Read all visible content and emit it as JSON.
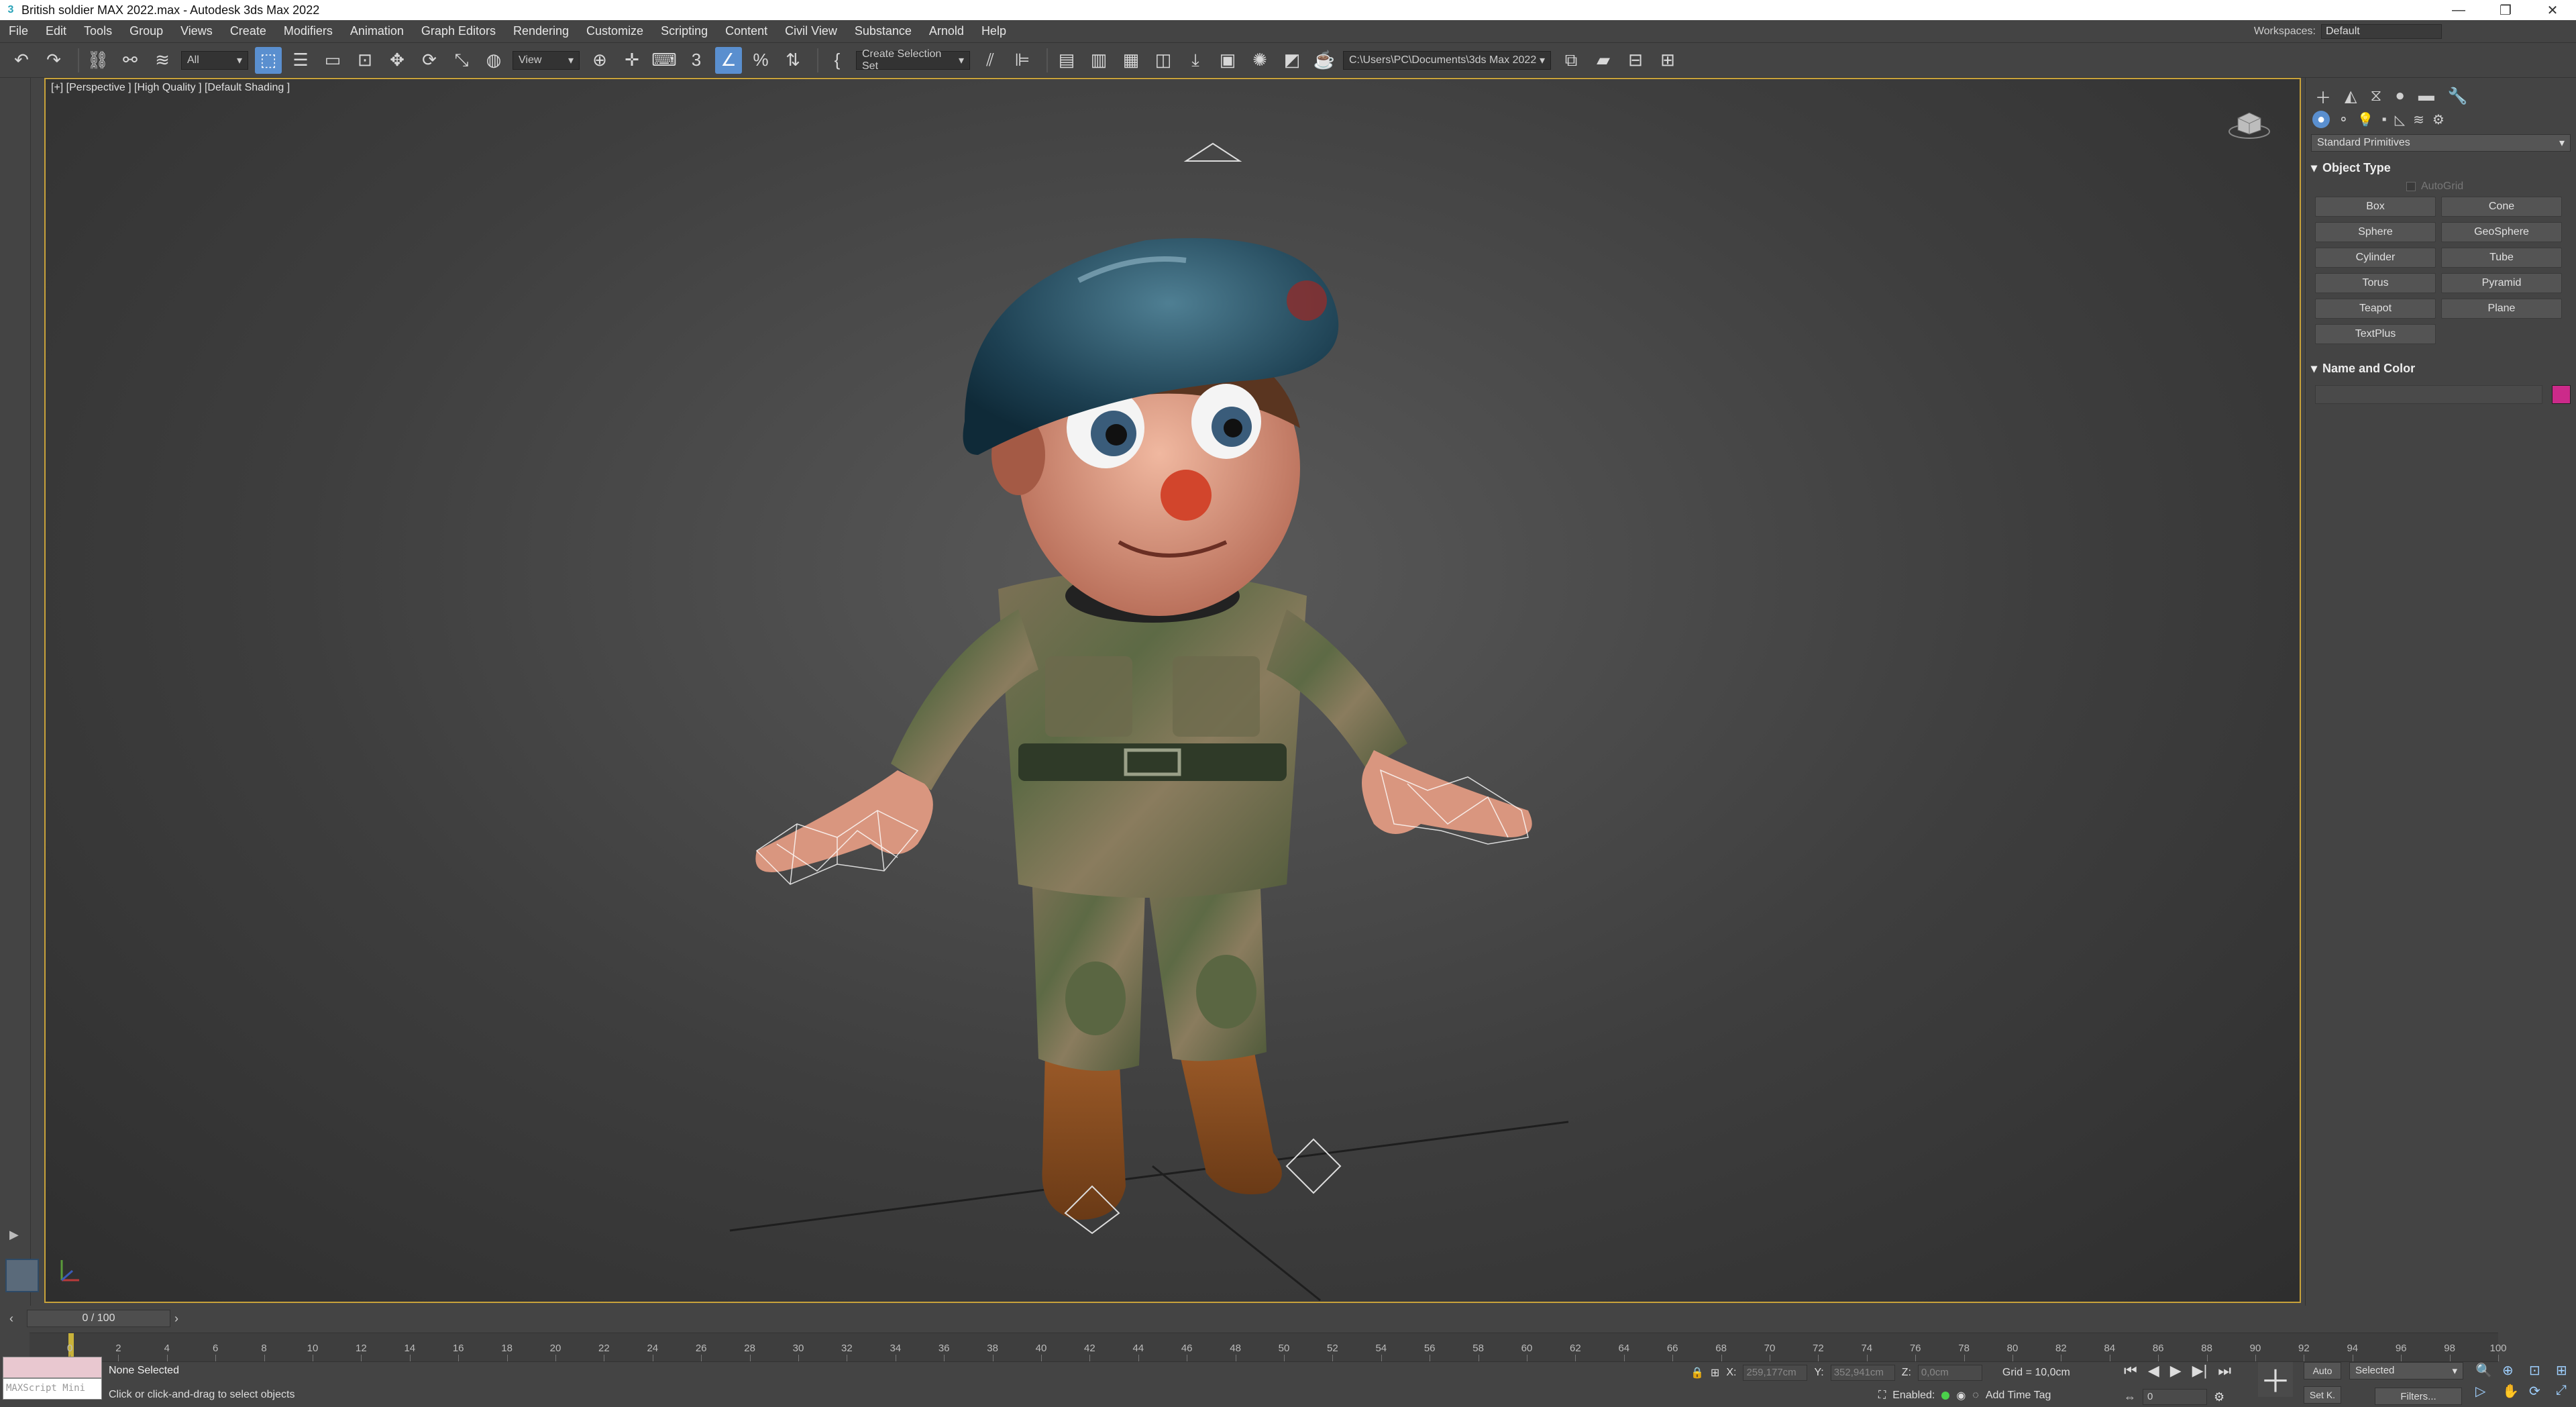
{
  "window": {
    "title": "British soldier MAX 2022.max - Autodesk 3ds Max 2022",
    "minimize": "—",
    "restore": "❐",
    "close": "✕"
  },
  "menubar": {
    "items": [
      "File",
      "Edit",
      "Tools",
      "Group",
      "Views",
      "Create",
      "Modifiers",
      "Animation",
      "Graph Editors",
      "Rendering",
      "Customize",
      "Scripting",
      "Content",
      "Civil View",
      "Substance",
      "Arnold",
      "Help"
    ],
    "workspace_label": "Workspaces:",
    "workspace_value": "Default"
  },
  "toolbar": {
    "selection_filter": "All",
    "ref_coord": "View",
    "selection_set": "Create Selection Set",
    "project_path": "C:\\Users\\PC\\Documents\\3ds Max 2022"
  },
  "viewport": {
    "label": "[+] [Perspective ] [High Quality ] [Default Shading ]",
    "accent_color": "#c8a23a"
  },
  "command_panel": {
    "category": "Standard Primitives",
    "object_type_title": "Object Type",
    "autogrid_label": "AutoGrid",
    "primitives": [
      "Box",
      "Cone",
      "Sphere",
      "GeoSphere",
      "Cylinder",
      "Tube",
      "Torus",
      "Pyramid",
      "Teapot",
      "Plane",
      "TextPlus"
    ],
    "name_color_title": "Name and Color",
    "object_color": "#cc2a8a"
  },
  "timeline": {
    "frame_display": "0 / 100",
    "ticks": [
      "0",
      "2",
      "4",
      "6",
      "8",
      "10",
      "12",
      "14",
      "16",
      "18",
      "20",
      "22",
      "24",
      "26",
      "28",
      "30",
      "32",
      "34",
      "36",
      "38",
      "40",
      "42",
      "44",
      "46",
      "48",
      "50",
      "52",
      "54",
      "56",
      "58",
      "60",
      "62",
      "64",
      "66",
      "68",
      "70",
      "72",
      "74",
      "76",
      "78",
      "80",
      "82",
      "84",
      "86",
      "88",
      "90",
      "92",
      "94",
      "96",
      "98",
      "100"
    ]
  },
  "status": {
    "selection": "None Selected",
    "prompt": "Click or click-and-drag to select objects",
    "maxscript_label": "MAXScript Mini",
    "x_label": "X:",
    "x_value": "259,177cm",
    "y_label": "Y:",
    "y_value": "352,941cm",
    "z_label": "Z:",
    "z_value": "0,0cm",
    "grid": "Grid = 10,0cm",
    "enabled_label": "Enabled:",
    "add_time_tag": "Add Time Tag",
    "current_frame": "0",
    "auto_label": "Auto",
    "setk_label": "Set K.",
    "key_filter": "Selected",
    "filters_label": "Filters..."
  }
}
